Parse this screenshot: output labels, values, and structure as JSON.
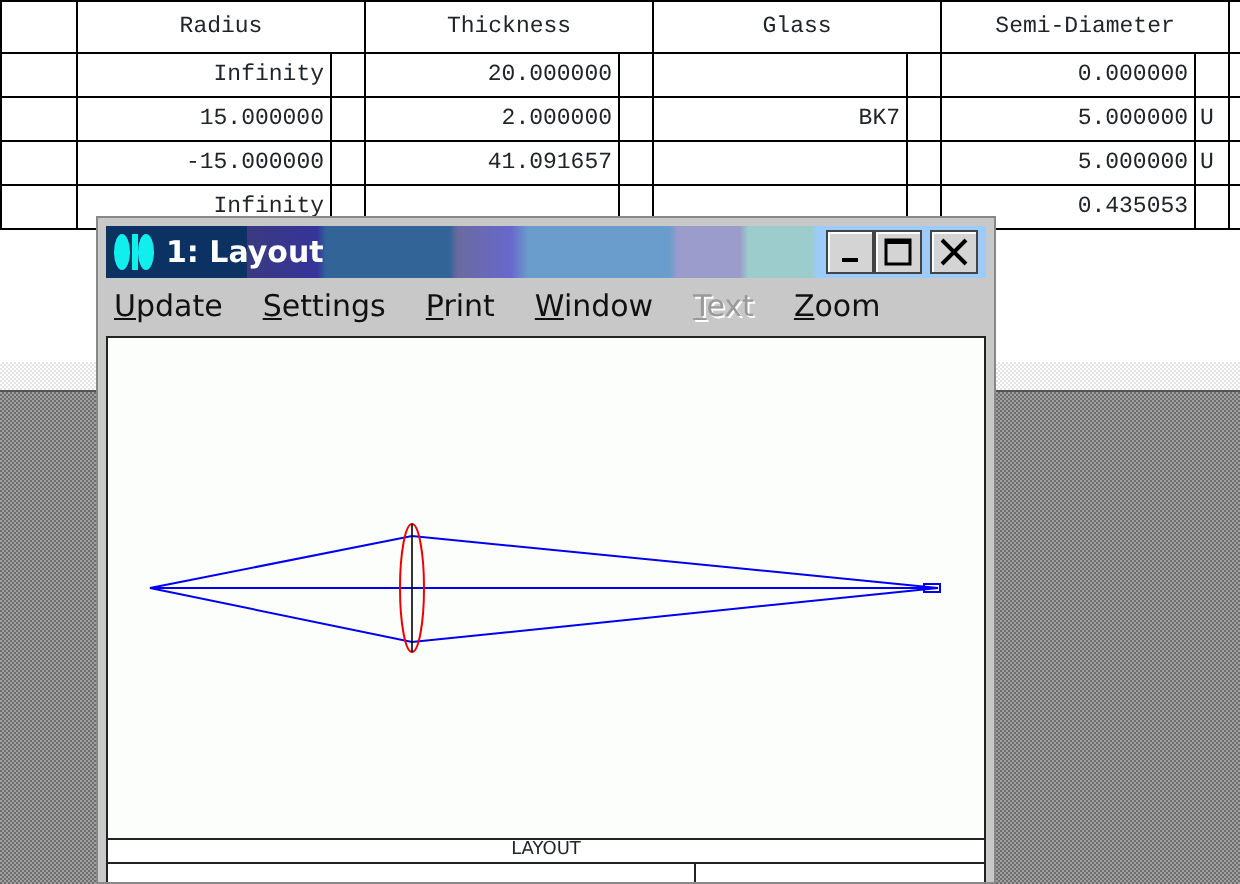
{
  "table": {
    "columns": [
      "Radius",
      "Thickness",
      "Glass",
      "Semi-Diameter"
    ],
    "rows": [
      {
        "radius": "Infinity",
        "thickness": "20.000000",
        "glass": "",
        "semi_diameter": "0.000000",
        "semi_diameter_solve": ""
      },
      {
        "radius": "15.000000",
        "thickness": "2.000000",
        "glass": "BK7",
        "semi_diameter": "5.000000",
        "semi_diameter_solve": "U"
      },
      {
        "radius": "-15.000000",
        "thickness": "41.091657",
        "glass": "",
        "semi_diameter": "5.000000",
        "semi_diameter_solve": "U"
      },
      {
        "radius": "Infinity",
        "thickness": "",
        "glass": "",
        "semi_diameter": "0.435053",
        "semi_diameter_solve": ""
      }
    ]
  },
  "layout_window": {
    "title": "1: Layout",
    "menu": [
      {
        "label": "Update",
        "disabled": false
      },
      {
        "label": "Settings",
        "disabled": false
      },
      {
        "label": "Print",
        "disabled": false
      },
      {
        "label": "Window",
        "disabled": false
      },
      {
        "label": "Text",
        "disabled": true
      },
      {
        "label": "Zoom",
        "disabled": false
      }
    ],
    "plot_label": "LAYOUT"
  }
}
